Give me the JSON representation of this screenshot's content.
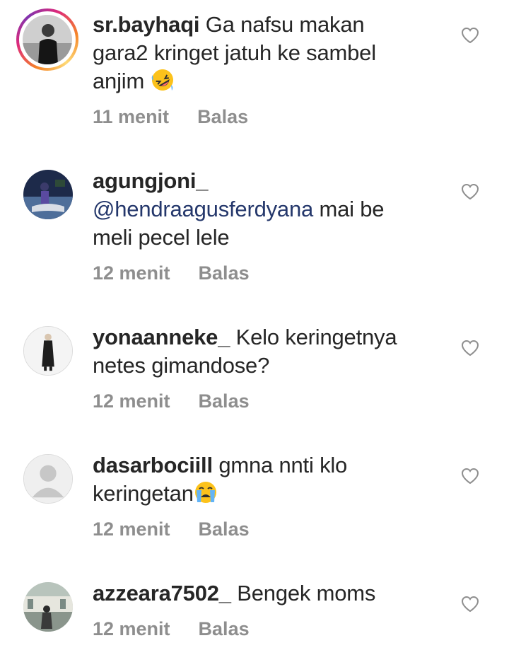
{
  "comments": [
    {
      "username": "sr.bayhaqi",
      "text": "Ga nafsu makan gara2 kringet jatuh ke sambel anjim",
      "line1": "Ga nafsu makan",
      "line2": "gara2 kringet jatuh ke sambel",
      "line3": "anjim",
      "emoji": "rolling-on-floor-laughing",
      "time": "11 menit",
      "reply_label": "Balas",
      "has_story_ring": true
    },
    {
      "username": "agungjoni_",
      "mention": "@hendraagusferdyana",
      "text_after_mention": "mai be",
      "line2": "meli pecel lele",
      "time": "12 menit",
      "reply_label": "Balas"
    },
    {
      "username": "yonaanneke_",
      "line1": "Kelo keringetnya",
      "line2": "netes gimandose?",
      "time": "12 menit",
      "reply_label": "Balas"
    },
    {
      "username": "dasarbociill",
      "line1": "gmna nnti klo",
      "line2": "keringetan",
      "emoji": "loudly-crying-face",
      "time": "12 menit",
      "reply_label": "Balas"
    },
    {
      "username": "azzeara7502_",
      "line1": "Bengek moms",
      "time": "12 menit",
      "reply_label": "Balas"
    }
  ],
  "colors": {
    "text": "#262626",
    "meta": "#8e8e8e",
    "mention": "#24376b"
  }
}
